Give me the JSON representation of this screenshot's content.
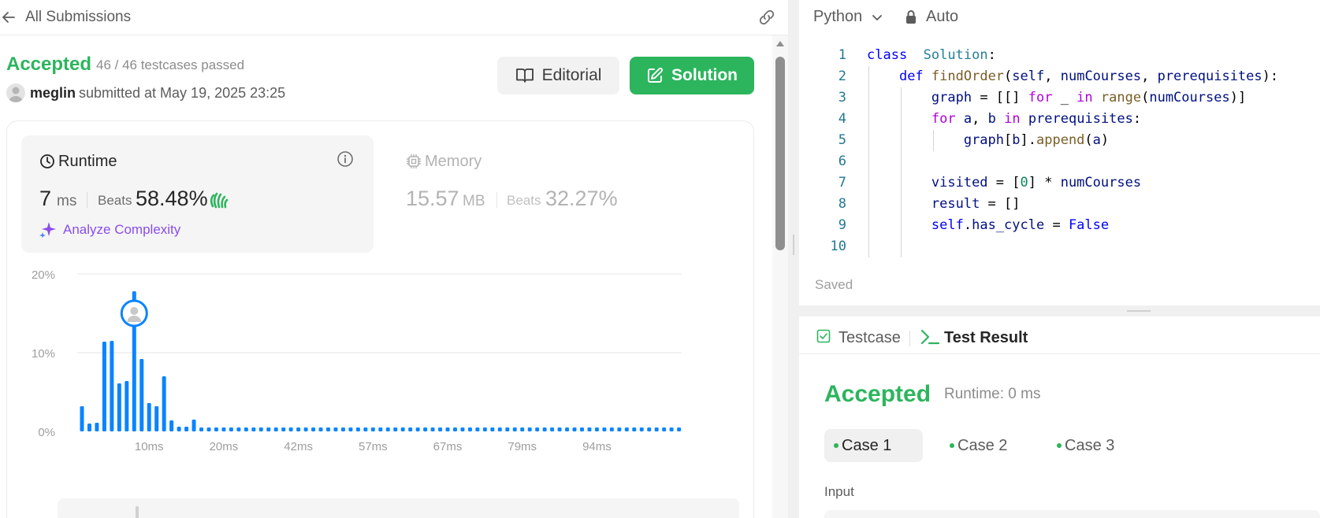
{
  "header": {
    "back_label": "All Submissions"
  },
  "submission": {
    "status": "Accepted",
    "testcases": "46 / 46 testcases passed",
    "username": "meglin",
    "submitted_text": "submitted at May 19, 2025 23:25"
  },
  "buttons": {
    "editorial": "Editorial",
    "solution": "Solution"
  },
  "runtime": {
    "title": "Runtime",
    "value": "7",
    "unit": "ms",
    "beats_label": "Beats",
    "beats_value": "58.48%",
    "analyze": "Analyze Complexity"
  },
  "memory": {
    "title": "Memory",
    "value": "15.57",
    "unit": "MB",
    "beats_label": "Beats",
    "beats_value": "32.27%"
  },
  "chart_data": {
    "type": "bar",
    "y_ticks": [
      "20%",
      "10%",
      "0%"
    ],
    "ylim": [
      0,
      20
    ],
    "x_ticks": [
      "10ms",
      "20ms",
      "42ms",
      "57ms",
      "67ms",
      "79ms",
      "94ms"
    ],
    "x_tick_bar_index": [
      9,
      19,
      29,
      39,
      49,
      59,
      69
    ],
    "values": [
      3.2,
      1.0,
      1.1,
      11.4,
      11.5,
      6.1,
      6.4,
      17.8,
      9.2,
      3.6,
      3.2,
      7.0,
      1.4,
      0.6,
      0.6,
      1.5,
      0.5,
      0.5,
      0.5,
      0.5,
      0.5,
      0.5,
      0.5,
      0.5,
      0.5,
      0.5,
      0.5,
      0.5,
      0.5,
      0.5,
      0.5,
      0.5,
      0.5,
      0.5,
      0.5,
      0.5,
      0.5,
      0.5,
      0.5,
      0.5,
      0.5,
      0.5,
      0.5,
      0.5,
      0.5,
      0.5,
      0.5,
      0.5,
      0.5,
      0.5,
      0.5,
      0.5,
      0.5,
      0.5,
      0.5,
      0.5,
      0.5,
      0.5,
      0.5,
      0.5,
      0.5,
      0.5,
      0.5,
      0.5,
      0.5,
      0.5,
      0.5,
      0.5,
      0.5,
      0.5,
      0.5,
      0.5,
      0.5,
      0.5,
      0.5,
      0.5,
      0.5,
      0.5,
      0.5,
      0.5,
      0.5
    ],
    "highlight_index": 7,
    "bar_color": "#0a84ff"
  },
  "editor": {
    "language": "Python",
    "mode": "Auto",
    "saved": "Saved",
    "lines": [
      {
        "n": "1",
        "tokens": [
          [
            "kw",
            "class"
          ],
          [
            "",
            "  "
          ],
          [
            "cls",
            "Solution"
          ],
          [
            "",
            ":"
          ]
        ]
      },
      {
        "n": "2",
        "tokens": [
          [
            "",
            "    "
          ],
          [
            "kw",
            "def"
          ],
          [
            "",
            " "
          ],
          [
            "fn",
            "findOrder"
          ],
          [
            "",
            "("
          ],
          [
            "var",
            "self"
          ],
          [
            "",
            ", "
          ],
          [
            "var",
            "numCourses"
          ],
          [
            "",
            ", "
          ],
          [
            "var",
            "prerequisites"
          ],
          [
            "",
            "):"
          ]
        ]
      },
      {
        "n": "3",
        "tokens": [
          [
            "",
            "        "
          ],
          [
            "var",
            "graph"
          ],
          [
            "",
            " = [[] "
          ],
          [
            "kw2",
            "for"
          ],
          [
            "",
            " _ "
          ],
          [
            "kw2",
            "in"
          ],
          [
            "",
            " "
          ],
          [
            "fn",
            "range"
          ],
          [
            "",
            "("
          ],
          [
            "var",
            "numCourses"
          ],
          [
            "",
            ")]"
          ]
        ]
      },
      {
        "n": "4",
        "tokens": [
          [
            "",
            "        "
          ],
          [
            "kw2",
            "for"
          ],
          [
            "",
            " "
          ],
          [
            "var",
            "a"
          ],
          [
            "",
            ", "
          ],
          [
            "var",
            "b"
          ],
          [
            "",
            " "
          ],
          [
            "kw2",
            "in"
          ],
          [
            "",
            " "
          ],
          [
            "var",
            "prerequisites"
          ],
          [
            "",
            ":"
          ]
        ]
      },
      {
        "n": "5",
        "tokens": [
          [
            "",
            "            "
          ],
          [
            "var",
            "graph"
          ],
          [
            "",
            "["
          ],
          [
            "var",
            "b"
          ],
          [
            "",
            "]."
          ],
          [
            "fn",
            "append"
          ],
          [
            "",
            "("
          ],
          [
            "var",
            "a"
          ],
          [
            "",
            ")"
          ]
        ]
      },
      {
        "n": "6",
        "tokens": []
      },
      {
        "n": "7",
        "tokens": [
          [
            "",
            "        "
          ],
          [
            "var",
            "visited"
          ],
          [
            "",
            " = ["
          ],
          [
            "num",
            "0"
          ],
          [
            "",
            "] * "
          ],
          [
            "var",
            "numCourses"
          ]
        ]
      },
      {
        "n": "8",
        "tokens": [
          [
            "",
            "        "
          ],
          [
            "var",
            "result"
          ],
          [
            "",
            " = []"
          ]
        ]
      },
      {
        "n": "9",
        "tokens": [
          [
            "",
            "        "
          ],
          [
            "kw",
            "self"
          ],
          [
            "",
            "."
          ],
          [
            "var",
            "has_cycle"
          ],
          [
            "",
            " = "
          ],
          [
            "kw",
            "False"
          ]
        ]
      },
      {
        "n": "10",
        "tokens": []
      }
    ]
  },
  "test_panel": {
    "tab_testcase": "Testcase",
    "tab_result": "Test Result",
    "status": "Accepted",
    "runtime": "Runtime: 0 ms",
    "cases": [
      "Case 1",
      "Case 2",
      "Case 3"
    ],
    "input_label": "Input"
  }
}
